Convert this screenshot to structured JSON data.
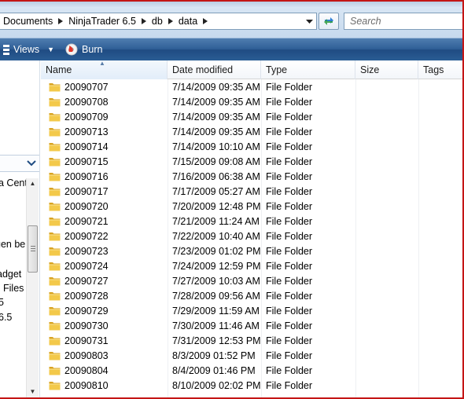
{
  "address": {
    "crumbs": [
      "Documents",
      "NinjaTrader 6.5",
      "db",
      "data"
    ]
  },
  "search": {
    "placeholder": "Search"
  },
  "toolbar": {
    "views_label": "Views",
    "burn_label": "Burn"
  },
  "nav": {
    "partial_labels": [
      "a Cent",
      "gen be",
      "adget",
      "Files",
      "5",
      "6.5"
    ]
  },
  "columns": {
    "name": "Name",
    "date": "Date modified",
    "type": "Type",
    "size": "Size",
    "tags": "Tags"
  },
  "files": [
    {
      "name": "20090707",
      "date": "7/14/2009 09:35 AM",
      "type": "File Folder"
    },
    {
      "name": "20090708",
      "date": "7/14/2009 09:35 AM",
      "type": "File Folder"
    },
    {
      "name": "20090709",
      "date": "7/14/2009 09:35 AM",
      "type": "File Folder"
    },
    {
      "name": "20090713",
      "date": "7/14/2009 09:35 AM",
      "type": "File Folder"
    },
    {
      "name": "20090714",
      "date": "7/14/2009 10:10 AM",
      "type": "File Folder"
    },
    {
      "name": "20090715",
      "date": "7/15/2009 09:08 AM",
      "type": "File Folder"
    },
    {
      "name": "20090716",
      "date": "7/16/2009 06:38 AM",
      "type": "File Folder"
    },
    {
      "name": "20090717",
      "date": "7/17/2009 05:27 AM",
      "type": "File Folder"
    },
    {
      "name": "20090720",
      "date": "7/20/2009 12:48 PM",
      "type": "File Folder"
    },
    {
      "name": "20090721",
      "date": "7/21/2009 11:24 AM",
      "type": "File Folder"
    },
    {
      "name": "20090722",
      "date": "7/22/2009 10:40 AM",
      "type": "File Folder"
    },
    {
      "name": "20090723",
      "date": "7/23/2009 01:02 PM",
      "type": "File Folder"
    },
    {
      "name": "20090724",
      "date": "7/24/2009 12:59 PM",
      "type": "File Folder"
    },
    {
      "name": "20090727",
      "date": "7/27/2009 10:03 AM",
      "type": "File Folder"
    },
    {
      "name": "20090728",
      "date": "7/28/2009 09:56 AM",
      "type": "File Folder"
    },
    {
      "name": "20090729",
      "date": "7/29/2009 11:59 AM",
      "type": "File Folder"
    },
    {
      "name": "20090730",
      "date": "7/30/2009 11:46 AM",
      "type": "File Folder"
    },
    {
      "name": "20090731",
      "date": "7/31/2009 12:53 PM",
      "type": "File Folder"
    },
    {
      "name": "20090803",
      "date": "8/3/2009 01:52 PM",
      "type": "File Folder"
    },
    {
      "name": "20090804",
      "date": "8/4/2009 01:46 PM",
      "type": "File Folder"
    },
    {
      "name": "20090810",
      "date": "8/10/2009 02:02 PM",
      "type": "File Folder"
    }
  ],
  "colors": {
    "toolbar": "#2f5f96",
    "frame_border": "#c41515",
    "folder": "#e8b830"
  }
}
